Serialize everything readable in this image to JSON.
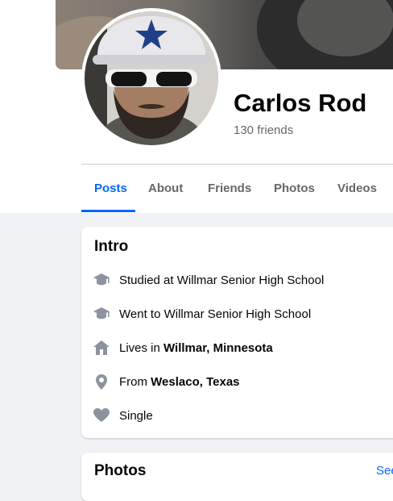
{
  "profile": {
    "name": "Carlos Rod",
    "friends": "130 friends"
  },
  "tabs": [
    {
      "label": "Posts",
      "active": true
    },
    {
      "label": "About",
      "active": false
    },
    {
      "label": "Friends",
      "active": false
    },
    {
      "label": "Photos",
      "active": false
    },
    {
      "label": "Videos",
      "active": false
    }
  ],
  "intro": {
    "title": "Intro",
    "items": [
      {
        "icon": "graduation-cap-icon",
        "prefix": "Studied at Willmar Senior High School",
        "bold": ""
      },
      {
        "icon": "graduation-cap-icon",
        "prefix": "Went to Willmar Senior High School",
        "bold": ""
      },
      {
        "icon": "home-icon",
        "prefix": "Lives in ",
        "bold": "Willmar, Minnesota"
      },
      {
        "icon": "location-pin-icon",
        "prefix": "From ",
        "bold": "Weslaco, Texas"
      },
      {
        "icon": "heart-icon",
        "prefix": "Single",
        "bold": ""
      }
    ]
  },
  "photos": {
    "title": "Photos",
    "see_all": "See all photos"
  },
  "colors": {
    "accent": "#0866ff",
    "icon": "#8c939d",
    "secondary_text": "#65676b"
  }
}
